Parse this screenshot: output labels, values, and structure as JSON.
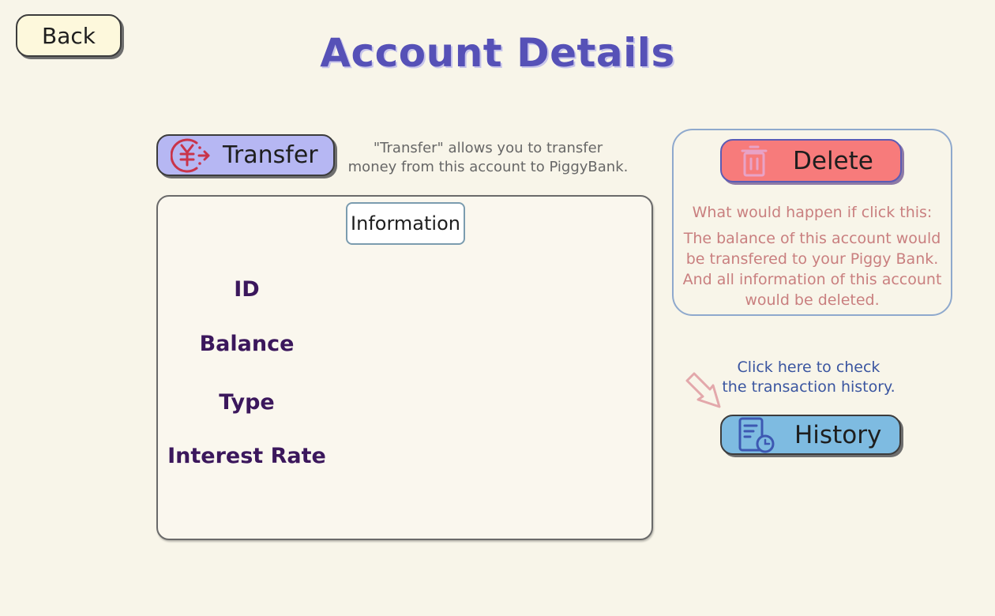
{
  "header": {
    "back_label": "Back",
    "title": "Account Details"
  },
  "transfer": {
    "label": "Transfer",
    "hint_line1": "\"Transfer\" allows you to transfer",
    "hint_line2": "money from this account to PiggyBank.",
    "icon": "yuan-transfer-icon"
  },
  "info_card": {
    "title": "Information",
    "fields": [
      {
        "label": "ID"
      },
      {
        "label": "Balance"
      },
      {
        "label": "Type"
      },
      {
        "label": "Interest Rate"
      }
    ]
  },
  "delete": {
    "label": "Delete",
    "icon": "trash-icon",
    "question": "What would happen if click this:",
    "desc_line1": "The balance of this account would",
    "desc_line2": "be transfered to your Piggy Bank.",
    "desc_line3": "And all information of this account",
    "desc_line4": "would be deleted."
  },
  "history": {
    "label": "History",
    "icon": "document-clock-icon",
    "hint_line1": "Click here to check",
    "hint_line2": "the transaction history."
  },
  "colors": {
    "background": "#f8f5e9",
    "title": "#5651b7",
    "transfer_button": "#b6b7f3",
    "delete_button": "#f77b7b",
    "history_button": "#7ebbe1",
    "back_button": "#fdf8dc",
    "field_label": "#3b175c",
    "delete_text": "#c97f7f",
    "history_hint": "#3a55a0"
  }
}
